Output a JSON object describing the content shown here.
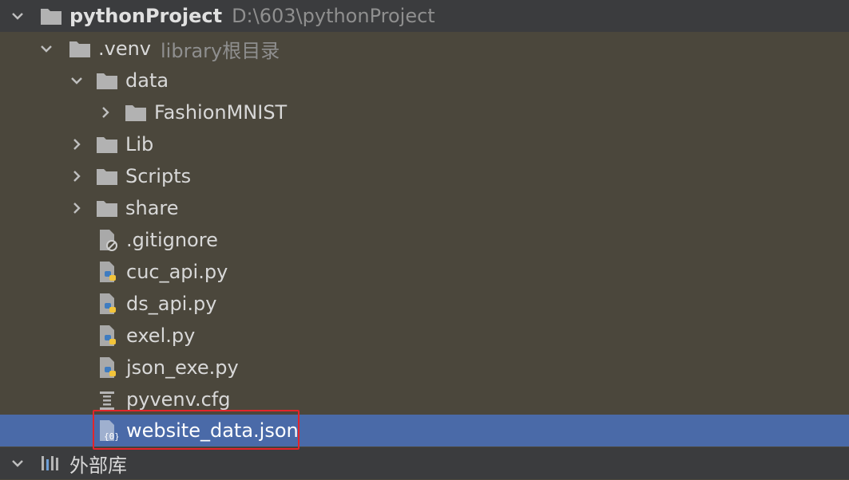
{
  "project": {
    "name": "pythonProject",
    "path": "D:\\603\\pythonProject"
  },
  "venv": {
    "name": ".venv",
    "hint": "library根目录"
  },
  "folders": {
    "data": "data",
    "fashion": "FashionMNIST",
    "lib": "Lib",
    "scripts": "Scripts",
    "share": "share"
  },
  "files": {
    "gitignore": ".gitignore",
    "cuc_api": "cuc_api.py",
    "ds_api": "ds_api.py",
    "exel": "exel.py",
    "json_exe": "json_exe.py",
    "pyvenv": "pyvenv.cfg",
    "website_data": "website_data.json"
  },
  "external": {
    "label": "外部库"
  },
  "icons": {
    "folder": "folder-icon",
    "python_file": "python-file-icon",
    "ignore_file": "ignore-file-icon",
    "config_file": "config-file-icon",
    "json_file": "json-file-icon",
    "library": "library-icon"
  },
  "colors": {
    "selection": "#4a6aa8",
    "highlight_border": "#e3252a",
    "background": "#4b473c"
  },
  "selected_item": "website_data.json"
}
